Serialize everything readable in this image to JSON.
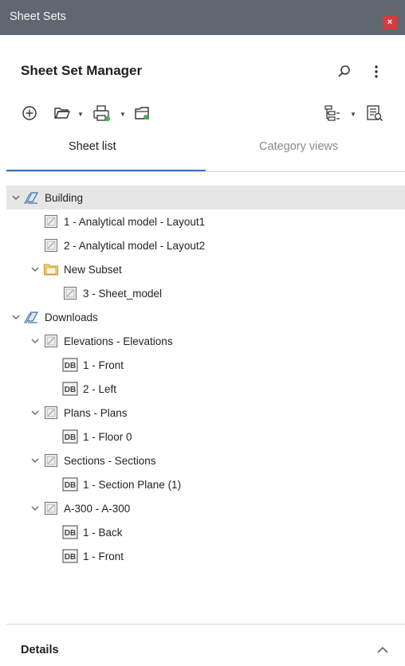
{
  "window": {
    "title": "Sheet Sets",
    "close_label": "×"
  },
  "header": {
    "title": "Sheet Set Manager"
  },
  "icons": {
    "search": "search-icon",
    "more": "kebab-menu-icon",
    "toolbar_left": [
      "add-icon",
      "open-folder-icon",
      "publish-icon",
      "sheet-set-icon"
    ],
    "toolbar_right": [
      "view-options-icon",
      "properties-icon"
    ]
  },
  "tabs": [
    {
      "label": "Sheet list",
      "active": true
    },
    {
      "label": "Category views",
      "active": false
    }
  ],
  "tree": [
    {
      "label": "Building",
      "icon": "sheet-set-icon",
      "level": 0,
      "expandable": true,
      "selected": true
    },
    {
      "label": "1 - Analytical model - Layout1",
      "icon": "sheet-icon",
      "level": 1,
      "expandable": false
    },
    {
      "label": "2 - Analytical model - Layout2",
      "icon": "sheet-icon",
      "level": 1,
      "expandable": false
    },
    {
      "label": "New Subset",
      "icon": "subset-folder-icon",
      "level": 1,
      "expandable": true
    },
    {
      "label": "3 - Sheet_model",
      "icon": "sheet-icon",
      "level": 2,
      "expandable": false
    },
    {
      "label": "Downloads",
      "icon": "sheet-set-icon",
      "level": 0,
      "expandable": true
    },
    {
      "label": "Elevations - Elevations",
      "icon": "sheet-icon",
      "level": 1,
      "expandable": true
    },
    {
      "label": "1 - Front",
      "icon": "drawing-icon",
      "level": 2,
      "expandable": false
    },
    {
      "label": "2 - Left",
      "icon": "drawing-icon",
      "level": 2,
      "expandable": false
    },
    {
      "label": "Plans - Plans",
      "icon": "sheet-icon",
      "level": 1,
      "expandable": true
    },
    {
      "label": "1 - Floor 0",
      "icon": "drawing-icon",
      "level": 2,
      "expandable": false
    },
    {
      "label": "Sections - Sections",
      "icon": "sheet-icon",
      "level": 1,
      "expandable": true
    },
    {
      "label": "1 - Section Plane (1)",
      "icon": "drawing-icon",
      "level": 2,
      "expandable": false
    },
    {
      "label": "A-300 - A-300",
      "icon": "sheet-icon",
      "level": 1,
      "expandable": true
    },
    {
      "label": "1 - Back",
      "icon": "drawing-icon",
      "level": 2,
      "expandable": false
    },
    {
      "label": "1 - Front",
      "icon": "drawing-icon",
      "level": 2,
      "expandable": false
    }
  ],
  "details": {
    "title": "Details",
    "collapsed": false
  },
  "colors": {
    "titlebar": "#5f6770",
    "close": "#d53a3f",
    "accent": "#3b74b8",
    "selected": "#e6e6e6"
  }
}
